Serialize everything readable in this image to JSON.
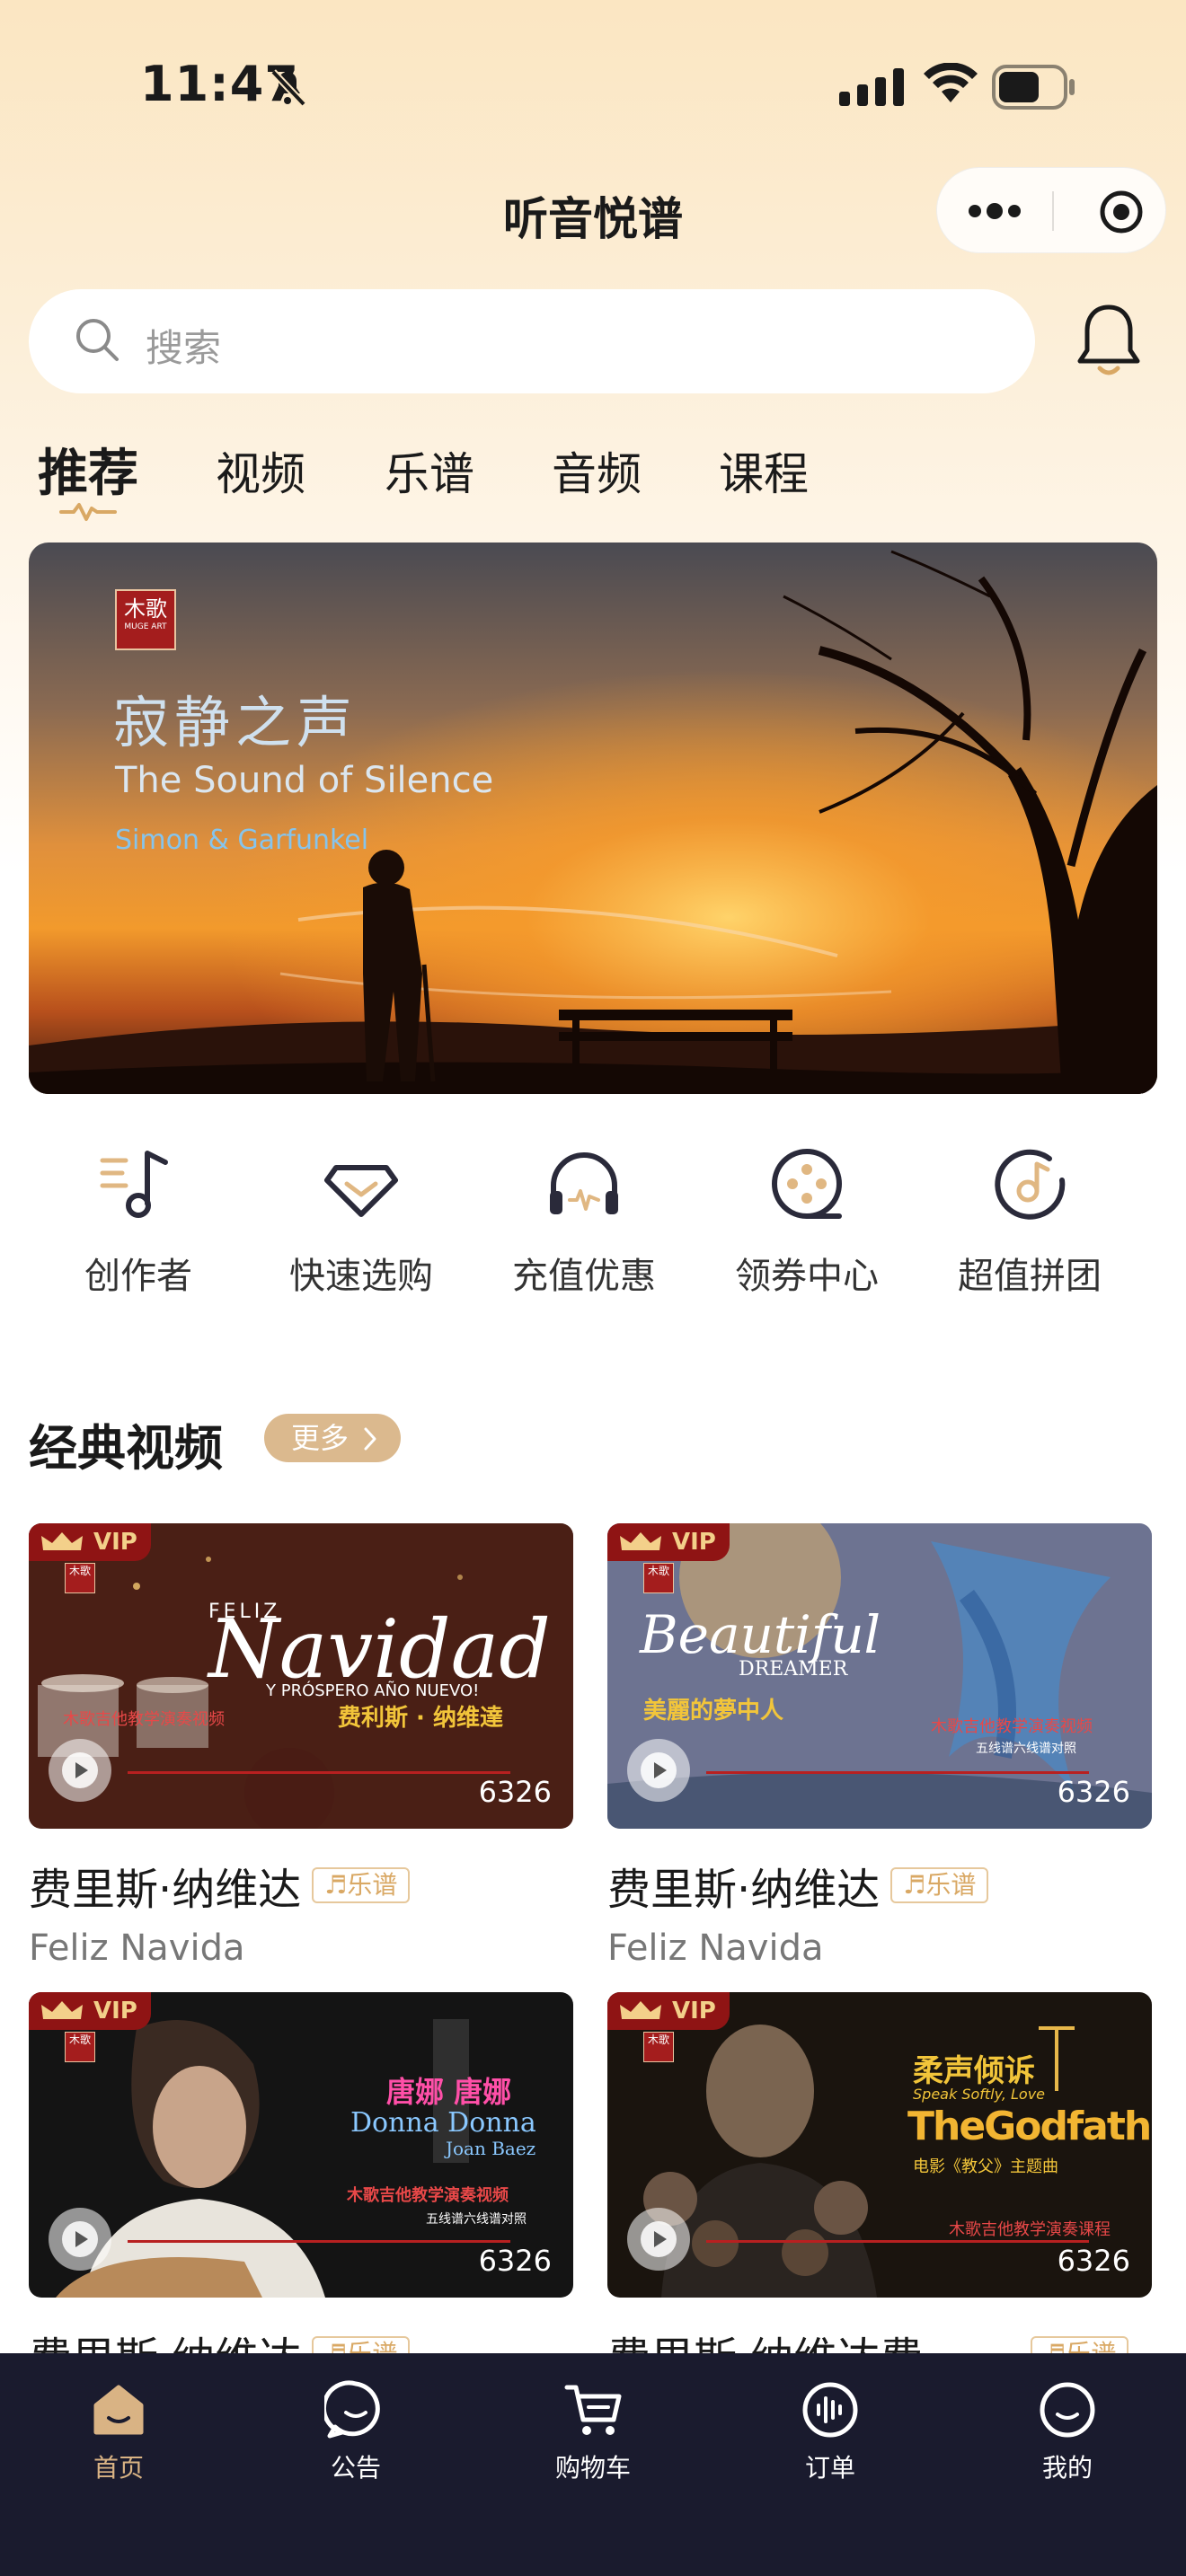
{
  "status_bar": {
    "time": "11:47"
  },
  "header": {
    "title": "听音悦谱"
  },
  "search": {
    "placeholder": "搜索"
  },
  "tabs": [
    {
      "label": "推荐",
      "active": true
    },
    {
      "label": "视频"
    },
    {
      "label": "乐谱"
    },
    {
      "label": "音频"
    },
    {
      "label": "课程"
    }
  ],
  "banner": {
    "logo": "木歌",
    "logo_sub": "MUGE ART",
    "title_cn": "寂静之声",
    "title_en": "The Sound of Silence",
    "artist": "Simon & Garfunkel"
  },
  "quick_menu": [
    {
      "label": "创作者",
      "icon": "music-note-icon"
    },
    {
      "label": "快速选购",
      "icon": "diamond-icon"
    },
    {
      "label": "充值优惠",
      "icon": "headphones-icon"
    },
    {
      "label": "领券中心",
      "icon": "film-reel-icon"
    },
    {
      "label": "超值拼团",
      "icon": "disc-icon"
    }
  ],
  "section": {
    "title": "经典视频",
    "more_label": "更多"
  },
  "videos": [
    {
      "title": "费里斯·纳维达",
      "tag": "乐谱",
      "subtitle": "Feliz Navida",
      "count": "6326",
      "vip": "VIP",
      "art_main": "Navidad",
      "art_top": "FELIZ",
      "art_sub": "Y PRÓSPERO AÑO NUEVO!",
      "art_cn": "费利斯 · 纳维達",
      "art_left": "木歌吉他教学演奏视频"
    },
    {
      "title": "费里斯·纳维达",
      "tag": "乐谱",
      "subtitle": "Feliz Navida",
      "count": "6326",
      "vip": "VIP",
      "art_main": "Beautiful",
      "art_top": "DREAMER",
      "art_cn": "美麗的夢中人",
      "art_right": "木歌吉他教学演奏视频",
      "art_small": "五线谱六线谱对照"
    },
    {
      "title": "费里斯·纳维达",
      "tag": "乐谱",
      "count": "6326",
      "vip": "VIP",
      "art_cn": "唐娜 唐娜",
      "art_main": "Donna Donna",
      "art_top": "Joan Baez",
      "art_right": "木歌吉他教学演奏视频",
      "art_small": "五线谱六线谱对照"
    },
    {
      "title": "费里斯·纳维达费",
      "tag": "乐谱",
      "count": "6326",
      "vip": "VIP",
      "art_cn": "柔声倾诉",
      "art_top": "Speak Softly, Love",
      "art_main": "TheGodfather",
      "art_sub": "电影《教父》主题曲",
      "art_right": "木歌吉他教学演奏课程"
    }
  ],
  "tabbar": [
    {
      "label": "首页",
      "icon": "home-icon",
      "active": true
    },
    {
      "label": "公告",
      "icon": "chat-bubble-icon"
    },
    {
      "label": "购物车",
      "icon": "cart-icon"
    },
    {
      "label": "订单",
      "icon": "voice-wave-icon"
    },
    {
      "label": "我的",
      "icon": "smile-icon"
    }
  ],
  "colors": {
    "accent": "#d9b384",
    "tabbar_bg": "#1a1b2e",
    "vip_red": "#8f1414"
  }
}
